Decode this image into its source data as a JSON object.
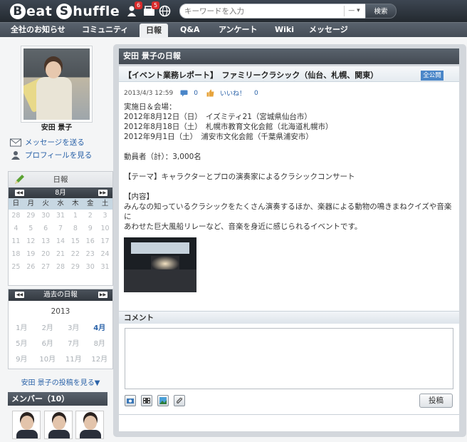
{
  "app": {
    "logo_word1": "Beat",
    "logo_word2": "Shuffle",
    "logo_initial1": "B",
    "logo_initial2": "S",
    "logo_rest1": "eat",
    "logo_rest2": "huffle"
  },
  "header": {
    "notif_count": "6",
    "mail_count": "5",
    "search_placeholder": "キーワードを入力",
    "search_select": "—",
    "search_button": "検索"
  },
  "nav": {
    "items": [
      "全社のお知らせ",
      "コミュニティ",
      "日報",
      "Q&A",
      "アンケート",
      "Wiki",
      "メッセージ"
    ],
    "active_index": 2
  },
  "profile": {
    "name": "安田 景子",
    "send_message": "メッセージを送る",
    "view_profile": "プロフィールを見る"
  },
  "calendar": {
    "title": "日報",
    "month": "8月",
    "weekdays": [
      "日",
      "月",
      "火",
      "水",
      "木",
      "金",
      "土"
    ],
    "days": [
      "28",
      "29",
      "30",
      "31",
      "1",
      "2",
      "3",
      "4",
      "5",
      "6",
      "7",
      "8",
      "9",
      "10",
      "11",
      "12",
      "13",
      "14",
      "15",
      "16",
      "17",
      "18",
      "19",
      "20",
      "21",
      "22",
      "23",
      "24",
      "25",
      "26",
      "27",
      "28",
      "29",
      "30",
      "31"
    ]
  },
  "archive": {
    "title": "過去の日報",
    "year": "2013",
    "months": [
      "1月",
      "2月",
      "3月",
      "4月",
      "5月",
      "6月",
      "7月",
      "8月",
      "9月",
      "10月",
      "11月",
      "12月"
    ],
    "active_month": "4月"
  },
  "more_posts": "安田 景子の投稿を見る▼",
  "members": {
    "title": "メンバー（10）"
  },
  "main": {
    "title": "安田 景子の日報",
    "post_title": "【イベント業務レポート】　ファミリークラシック（仙台、札幌、関東）",
    "visibility": "全公開",
    "date": "2013/4/3 12:59",
    "comment_count": "0",
    "like_label": "いいね！",
    "like_count": "0",
    "body": [
      "実施日＆会場：",
      "2012年8月12日（日）　イズミティ21（宮城県仙台市）",
      "2012年8月18日（土）　札幌市教育文化会館（北海道札幌市）",
      "2012年9月1日（土）　浦安市文化会館（千葉県浦安市）",
      "",
      "動員者（計）：3,000名",
      "",
      "【テーマ】キャラクターとプロの演奏家によるクラシックコンサート",
      "",
      "【内容】",
      "みんなの知っているクラシックをたくさん演奏するほか、楽器による動物の鳴きまねクイズや音楽に",
      "あわせた巨大風船リレーなど、音楽を身近に感じられるイベントです。"
    ],
    "comment_label": "コメント",
    "post_button": "投稿"
  },
  "colors": {
    "accent_link": "#2a62a8",
    "badge_red": "#d72b2b",
    "visibility_blue": "#4a86c8"
  }
}
